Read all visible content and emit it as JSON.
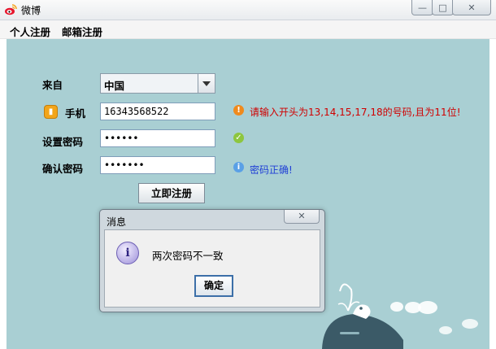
{
  "window": {
    "title": "微博",
    "minimize": "—",
    "maximize": "□",
    "close": "✕"
  },
  "menu": [
    "个人注册",
    "邮箱注册"
  ],
  "form": {
    "from_label": "来自",
    "country_value": "中国",
    "phone_label": "手机",
    "phone_value": "16343568522",
    "phone_error": "请输入开头为13,14,15,17,18的号码,且为11位!",
    "password_label": "设置密码",
    "password_value": "••••••",
    "confirm_label": "确认密码",
    "confirm_value": "•••••••",
    "confirm_info": "密码正确!",
    "register_button": "立即注册"
  },
  "dialog": {
    "title": "消息",
    "close": "✕",
    "message": "两次密码不一致",
    "ok_button": "确定",
    "icon_glyph": "i"
  },
  "icons": {
    "error_glyph": "!",
    "check_glyph": "✓",
    "info_glyph": "i",
    "phone_badge_color": "#f2a51a",
    "error_color": "#f08a1c",
    "check_color": "#8dc63f",
    "info_color": "#5aa0e6"
  },
  "colors": {
    "background": "#a9cfd3",
    "error_text": "#d00000",
    "info_text": "#1f3fd6"
  }
}
